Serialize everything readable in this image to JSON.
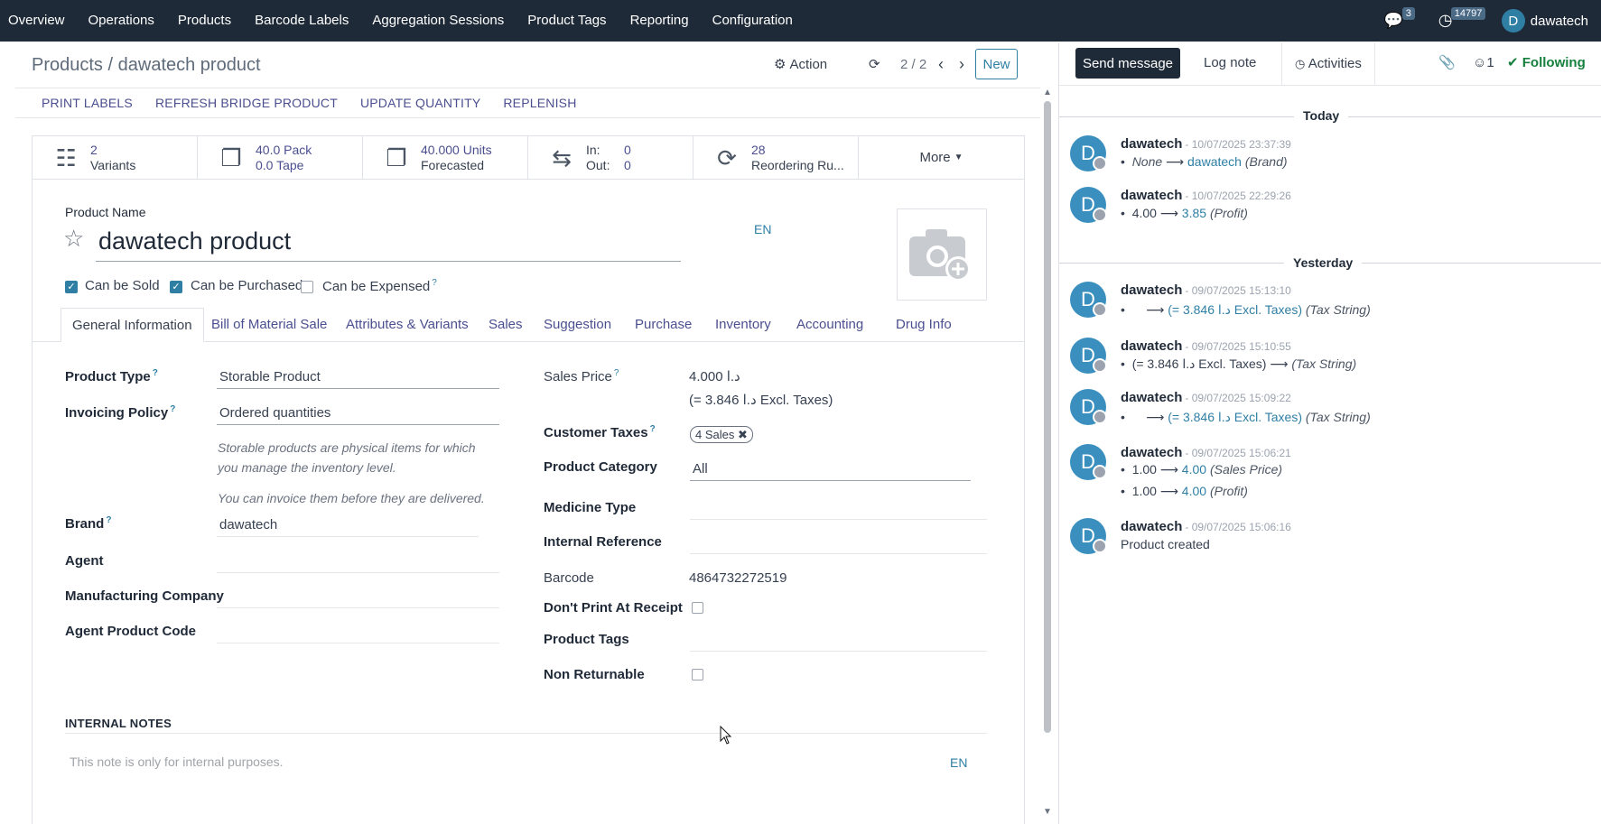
{
  "topnav": {
    "menu": [
      "Overview",
      "Operations",
      "Products",
      "Barcode Labels",
      "Aggregation Sessions",
      "Product Tags",
      "Reporting",
      "Configuration"
    ],
    "messages_badge": "3",
    "activity_badge": "14797",
    "user_initial": "D",
    "user_name": "dawatech"
  },
  "breadcrumb": {
    "parent": "Products",
    "sep": "/",
    "current": "dawatech product"
  },
  "controls": {
    "action": "Action",
    "pager": "2 / 2",
    "new": "New"
  },
  "action_buttons": [
    "PRINT LABELS",
    "REFRESH BRIDGE PRODUCT",
    "UPDATE QUANTITY",
    "REPLENISH"
  ],
  "stats": {
    "variants": {
      "value": "2",
      "label": "Variants"
    },
    "pack": {
      "line1": "40.0 Pack",
      "line2": "0.0 Tape"
    },
    "forecast": {
      "value": "40.000 Units",
      "label": "Forecasted"
    },
    "inout": {
      "in_label": "In:",
      "in_value": "0",
      "out_label": "Out:",
      "out_value": "0"
    },
    "reordering": {
      "value": "28",
      "label": "Reordering Ru..."
    },
    "more": "More"
  },
  "product": {
    "name_label": "Product Name",
    "name": "dawatech product",
    "lang": "EN",
    "can_be_sold": "Can be Sold",
    "can_be_purchased": "Can be Purchased",
    "can_be_expensed": "Can be Expensed",
    "help_mark": "?"
  },
  "tabs": [
    "General Information",
    "Bill of Material Sale",
    "Attributes & Variants",
    "Sales",
    "Suggestion",
    "Purchase",
    "Inventory",
    "Accounting",
    "Drug Info"
  ],
  "left_fields": {
    "product_type_label": "Product Type",
    "product_type": "Storable Product",
    "invoicing_label": "Invoicing Policy",
    "invoicing": "Ordered quantities",
    "help1": "Storable products are physical items for which",
    "help2": "you manage the inventory level.",
    "help3": "You can invoice them before they are delivered.",
    "brand_label": "Brand",
    "brand": "dawatech",
    "agent_label": "Agent",
    "mfg_label": "Manufacturing Company",
    "agent_code_label": "Agent Product Code"
  },
  "right_fields": {
    "sales_price_label": "Sales Price",
    "sales_price": "4.000  د.ا",
    "excl_taxes": "(= 3.846  د.ا Excl. Taxes)",
    "customer_taxes_label": "Customer Taxes",
    "customer_taxes_tag": "4 Sales",
    "category_label": "Product Category",
    "category": "All",
    "medicine_label": "Medicine Type",
    "internal_ref_label": "Internal Reference",
    "barcode_label": "Barcode",
    "barcode": "4864732272519",
    "dont_print_label": "Don't Print At Receipt",
    "product_tags_label": "Product Tags",
    "non_returnable_label": "Non Returnable"
  },
  "notes": {
    "label": "INTERNAL NOTES",
    "placeholder": "This note is only for internal purposes.",
    "lang": "EN"
  },
  "chatter": {
    "send_message": "Send message",
    "log_note": "Log note",
    "activities": "Activities",
    "followers": "1",
    "following": "Following",
    "today": "Today",
    "yesterday": "Yesterday",
    "messages": [
      {
        "author": "dawatech",
        "date": "- 10/07/2025 23:37:39",
        "old": "None",
        "new": "dawatech",
        "field": "(Brand)"
      },
      {
        "author": "dawatech",
        "date": "- 10/07/2025 22:29:26",
        "old": "4.00",
        "new": "3.85",
        "field": "(Profit)"
      },
      {
        "author": "dawatech",
        "date": "- 09/07/2025 15:13:10",
        "old": "",
        "new": "(= 3.846  د.ا Excl. Taxes)",
        "field": "(Tax String)"
      },
      {
        "author": "dawatech",
        "date": "- 09/07/2025 15:10:55",
        "old": "(= 3.846  د.ا Excl. Taxes)",
        "new": "",
        "field": "(Tax String)"
      },
      {
        "author": "dawatech",
        "date": "- 09/07/2025 15:09:22",
        "old": "",
        "new": "(= 3.846  د.ا Excl. Taxes)",
        "field": "(Tax String)"
      },
      {
        "author": "dawatech",
        "date": "- 09/07/2025 15:06:21",
        "old": "1.00",
        "new": "4.00",
        "field": "(Sales Price)",
        "old2": "1.00",
        "new2": "4.00",
        "field2": "(Profit)"
      },
      {
        "author": "dawatech",
        "date": "- 09/07/2025 15:06:16",
        "text": "Product created"
      }
    ],
    "avatar_initial": "D"
  }
}
